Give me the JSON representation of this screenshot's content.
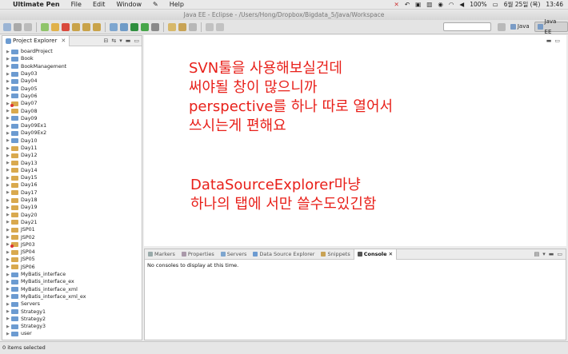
{
  "menubar": {
    "app": "Ultimate Pen",
    "items": [
      "File",
      "Edit",
      "Window",
      "Help"
    ],
    "battery": "100%",
    "date": "6월 25일 (목)",
    "time": "13:46"
  },
  "window": {
    "title": "Java EE - Eclipse - /Users/Hong/Dropbox/Bigdata_5/Java/Workspace"
  },
  "perspectives": [
    {
      "label": "Java",
      "active": false
    },
    {
      "label": "Java EE",
      "active": true
    }
  ],
  "explorer": {
    "title": "Project Explorer",
    "projects": [
      {
        "name": "boardProject",
        "kind": "plain"
      },
      {
        "name": "Book",
        "kind": "plain"
      },
      {
        "name": "BookManagement",
        "kind": "plain"
      },
      {
        "name": "Day03",
        "kind": "plain"
      },
      {
        "name": "Day04",
        "kind": "plain"
      },
      {
        "name": "Day05",
        "kind": "plain"
      },
      {
        "name": "Day06",
        "kind": "plain"
      },
      {
        "name": "Day07",
        "kind": "err"
      },
      {
        "name": "Day08",
        "kind": "web"
      },
      {
        "name": "Day09",
        "kind": "plain"
      },
      {
        "name": "Day09Ex1",
        "kind": "plain"
      },
      {
        "name": "Day09Ex2",
        "kind": "plain"
      },
      {
        "name": "Day10",
        "kind": "plain"
      },
      {
        "name": "Day11",
        "kind": "web"
      },
      {
        "name": "Day12",
        "kind": "web"
      },
      {
        "name": "Day13",
        "kind": "web"
      },
      {
        "name": "Day14",
        "kind": "web"
      },
      {
        "name": "Day15",
        "kind": "web"
      },
      {
        "name": "Day16",
        "kind": "web"
      },
      {
        "name": "Day17",
        "kind": "web"
      },
      {
        "name": "Day18",
        "kind": "web"
      },
      {
        "name": "Day19",
        "kind": "web"
      },
      {
        "name": "Day20",
        "kind": "web"
      },
      {
        "name": "Day21",
        "kind": "web"
      },
      {
        "name": "JSP01",
        "kind": "web"
      },
      {
        "name": "JSP02",
        "kind": "web"
      },
      {
        "name": "JSP03",
        "kind": "err"
      },
      {
        "name": "JSP04",
        "kind": "web"
      },
      {
        "name": "JSP05",
        "kind": "web"
      },
      {
        "name": "JSP06",
        "kind": "web"
      },
      {
        "name": "MyBatis_interface",
        "kind": "plain"
      },
      {
        "name": "MyBatis_interface_ex",
        "kind": "plain"
      },
      {
        "name": "MyBatis_interface_xml",
        "kind": "plain"
      },
      {
        "name": "MyBatis_interface_xml_ex",
        "kind": "plain"
      },
      {
        "name": "Servers",
        "kind": "plain"
      },
      {
        "name": "Strategy1",
        "kind": "plain"
      },
      {
        "name": "Strategy2",
        "kind": "plain"
      },
      {
        "name": "Strategy3",
        "kind": "plain"
      },
      {
        "name": "user",
        "kind": "plain"
      }
    ]
  },
  "editor": {
    "note1": [
      "SVN툴을 사용해보실건데",
      "써야될 창이 많으니까",
      "perspective를 하나 따로 열어서",
      "쓰시는게 편해요"
    ],
    "note2": [
      "DataSourceExplorer마냥",
      "하나의 탭에 서만 쓸수도있긴함"
    ],
    "note_color": "#e8201a"
  },
  "panel": {
    "tabs": [
      "Markers",
      "Properties",
      "Servers",
      "Data Source Explorer",
      "Snippets",
      "Console"
    ],
    "active_tab": "Console",
    "message": "No consoles to display at this time."
  },
  "status": {
    "text": "0 items selected"
  }
}
